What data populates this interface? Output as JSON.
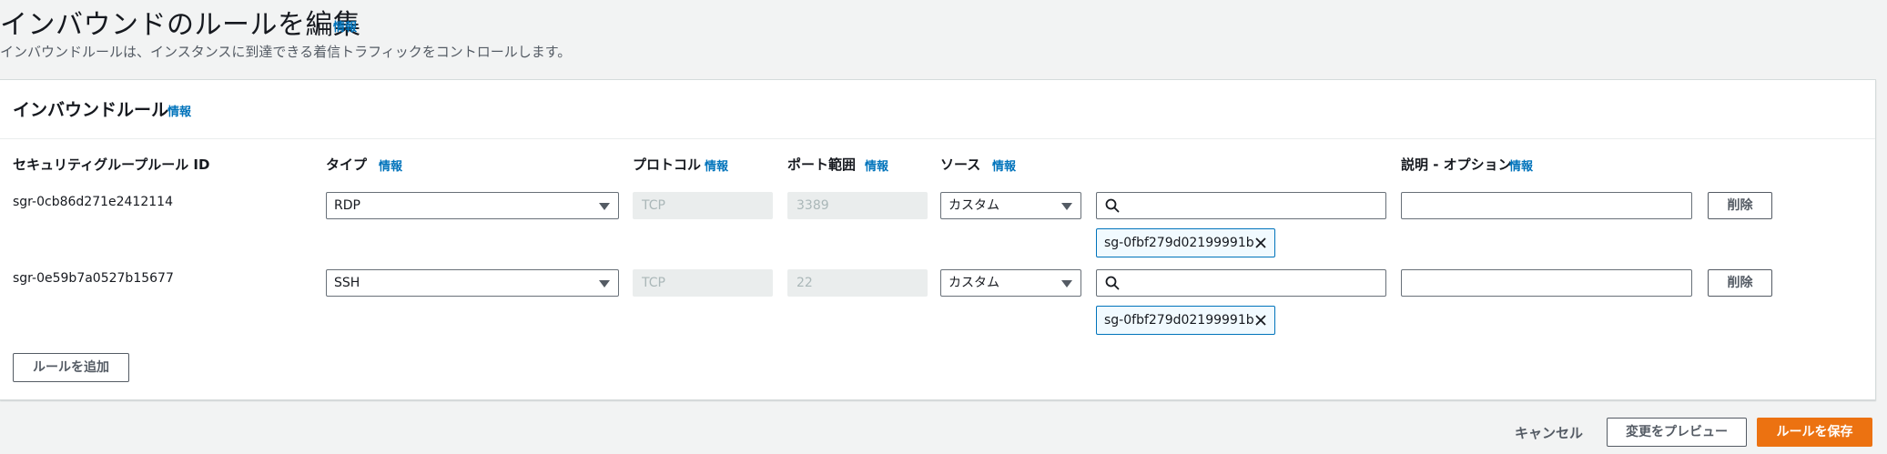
{
  "page": {
    "title": "インバウンドのルールを編集",
    "title_info": "情報",
    "description": "インバウンドルールは、インスタンスに到達できる着信トラフィックをコントロールします。"
  },
  "panel": {
    "title": "インバウンドルール",
    "title_info": "情報",
    "columns": {
      "rule_id": "セキュリティグループルール ID",
      "type": "タイプ",
      "type_info": "情報",
      "protocol": "プロトコル",
      "protocol_info": "情報",
      "port_range": "ポート範囲",
      "port_range_info": "情報",
      "source": "ソース",
      "source_info": "情報",
      "description": "説明 - オプション",
      "description_info": "情報"
    },
    "rules": [
      {
        "id": "sgr-0cb86d271e2412114",
        "type": "RDP",
        "protocol": "TCP",
        "port": "3389",
        "source": "カスタム",
        "search_value": "",
        "token": "sg-0fbf279d02199991b",
        "description": "",
        "delete_label": "削除"
      },
      {
        "id": "sgr-0e59b7a0527b15677",
        "type": "SSH",
        "protocol": "TCP",
        "port": "22",
        "source": "カスタム",
        "search_value": "",
        "token": "sg-0fbf279d02199991b",
        "description": "",
        "delete_label": "削除"
      }
    ],
    "add_rule_label": "ルールを追加"
  },
  "footer": {
    "cancel_label": "キャンセル",
    "preview_label": "変更をプレビュー",
    "save_label": "ルールを保存"
  },
  "icons": {
    "search": "search-icon",
    "remove_token": "close-icon",
    "dropdown": "caret-down-icon"
  },
  "colors": {
    "link": "#0073bb",
    "primary": "#ec7211",
    "background": "#f2f3f3"
  }
}
